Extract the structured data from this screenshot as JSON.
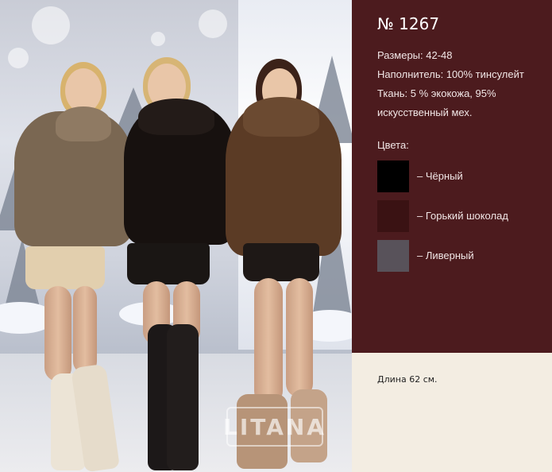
{
  "product": {
    "number": "№ 1267",
    "sizes": "Размеры: 42-48",
    "filling": "Наполнитель: 100% тинсулейт",
    "fabric_line1": "Ткань: 5 % экокожа, 95%",
    "fabric_line2": "искусственный мех.",
    "colors_title": "Цвета:",
    "colors": [
      {
        "label": "– Чёрный",
        "hex": "#000000"
      },
      {
        "label": "– Горький шоколад",
        "hex": "#3a1213"
      },
      {
        "label": "– Ливерный",
        "hex": "#58525a"
      }
    ],
    "length": "Длина 62 см."
  },
  "photo": {
    "logo_text": "LITANA",
    "models": [
      {
        "jacket_color": "#7a6752",
        "shorts_color": "#e2cfae",
        "boot_color": "#ece4d6"
      },
      {
        "jacket_color": "#17110f",
        "shorts_color": "#1a1614",
        "boot_color": "#1c1818"
      },
      {
        "jacket_color": "#5b3b25",
        "shorts_color": "#1e1816",
        "boot_color": "#b79478"
      }
    ]
  },
  "theme": {
    "panel_bg": "#4c1b1e",
    "cream_bg": "#f3ede2"
  }
}
